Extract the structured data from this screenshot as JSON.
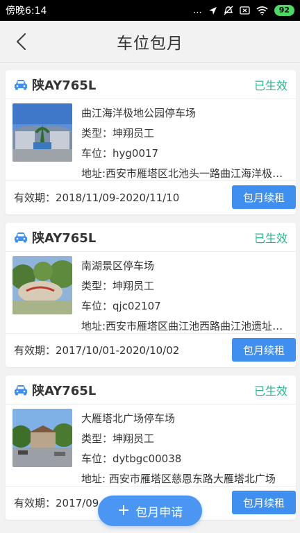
{
  "status_bar": {
    "time": "傍晚6:14",
    "dots": "...",
    "battery": "92"
  },
  "header": {
    "title": "车位包月"
  },
  "cards": [
    {
      "plate": "陕AY765L",
      "status": "已生效",
      "lot_name": "曲江海洋极地公园停车场",
      "type_line": "类型：坤翔员工",
      "space_line": "车位：hyg0017",
      "address_line": "地址:西安市雁塔区北池头一路曲江海洋极地公园",
      "validity": "有效期：2018/11/09-2020/11/10",
      "renew_label": "包月续租"
    },
    {
      "plate": "陕AY765L",
      "status": "已生效",
      "lot_name": "南湖景区停车场",
      "type_line": "类型：坤翔员工",
      "space_line": "车位：qjc02107",
      "address_line": "地址:西安市雁塔区曲江池西路曲江池遗址公园",
      "validity": "有效期：2017/10/01-2020/10/02",
      "renew_label": "包月续租"
    },
    {
      "plate": "陕AY765L",
      "status": "已生效",
      "lot_name": "大雁塔北广场停车场",
      "type_line": "类型：坤翔员工",
      "space_line": "车位：dytbgc00038",
      "address_line": "地址: 西安市雁塔区慈恩东路大雁塔北广场",
      "validity": "有效期：2017/09",
      "renew_label": "包月续租"
    }
  ],
  "fab": {
    "label": "包月申请"
  },
  "colors": {
    "accent": "#3f8ff0",
    "active_status": "#2ab590",
    "car_icon": "#3f8ff0"
  }
}
